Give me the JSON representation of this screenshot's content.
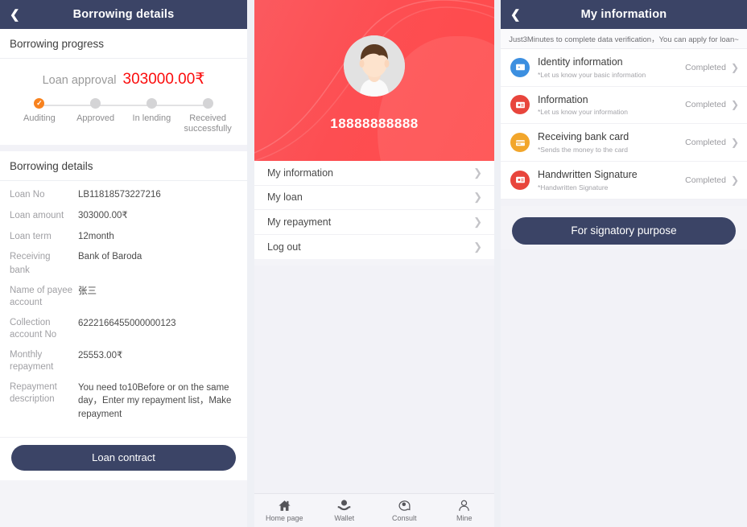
{
  "panel1": {
    "navbar": {
      "back_icon": "chevron-left-icon",
      "title": "Borrowing details"
    },
    "progress_section_title": "Borrowing progress",
    "approval": {
      "label": "Loan approval",
      "amount": "303000.00₹",
      "amount_color": "#fb0c0c"
    },
    "steps": [
      {
        "label": "Auditing",
        "state": "done"
      },
      {
        "label": "Approved",
        "state": "pending"
      },
      {
        "label": "In lending",
        "state": "pending"
      },
      {
        "label": "Received successfully",
        "state": "pending"
      }
    ],
    "details_section_title": "Borrowing details",
    "details": [
      {
        "key": "Loan No",
        "value": "LB11818573227216"
      },
      {
        "key": "Loan amount",
        "value": "303000.00₹"
      },
      {
        "key": "Loan term",
        "value": "12month"
      },
      {
        "key": "Receiving bank",
        "value": "Bank of Baroda"
      },
      {
        "key": "Name of payee account",
        "value": "张三"
      },
      {
        "key": "Collection account No",
        "value": "6222166455000000123"
      },
      {
        "key": "Monthly repayment",
        "value": "25553.00₹"
      },
      {
        "key": "Repayment description",
        "value": "You need to10Before or on the same day，Enter my repayment list，Make repayment"
      }
    ],
    "contract_button": "Loan contract"
  },
  "panel2": {
    "avatar_icon": "user-avatar-icon",
    "phone_number": "18888888888",
    "menu": [
      {
        "label": "My information",
        "chevron": "chevron-right-icon"
      },
      {
        "label": "My loan",
        "chevron": "chevron-right-icon"
      },
      {
        "label": "My repayment",
        "chevron": "chevron-right-icon"
      },
      {
        "label": "Log out",
        "chevron": "chevron-right-icon"
      }
    ],
    "tabbar": [
      {
        "label": "Home page",
        "icon": "home-icon"
      },
      {
        "label": "Wallet",
        "icon": "wallet-icon"
      },
      {
        "label": "Consult",
        "icon": "consult-icon"
      },
      {
        "label": "Mine",
        "icon": "person-icon"
      }
    ]
  },
  "panel3": {
    "navbar": {
      "back_icon": "chevron-left-icon",
      "title": "My information"
    },
    "notice": "Just3Minutes to complete data verification，You can apply for loan~",
    "items": [
      {
        "title": "Identity information",
        "subtitle": "*Let us know your basic information",
        "status": "Completed",
        "icon": "id-card-icon",
        "icon_color": "#3c8fe0"
      },
      {
        "title": "Information",
        "subtitle": "*Let us know your information",
        "status": "Completed",
        "icon": "id-card-icon",
        "icon_color": "#e8453c"
      },
      {
        "title": "Receiving bank card",
        "subtitle": "*Sends the money to the card",
        "status": "Completed",
        "icon": "credit-card-icon",
        "icon_color": "#f2a62b"
      },
      {
        "title": "Handwritten Signature",
        "subtitle": "*Handwritten Signature",
        "status": "Completed",
        "icon": "id-card-icon",
        "icon_color": "#e8453c"
      }
    ],
    "signatory_button": "For signatory purpose"
  }
}
